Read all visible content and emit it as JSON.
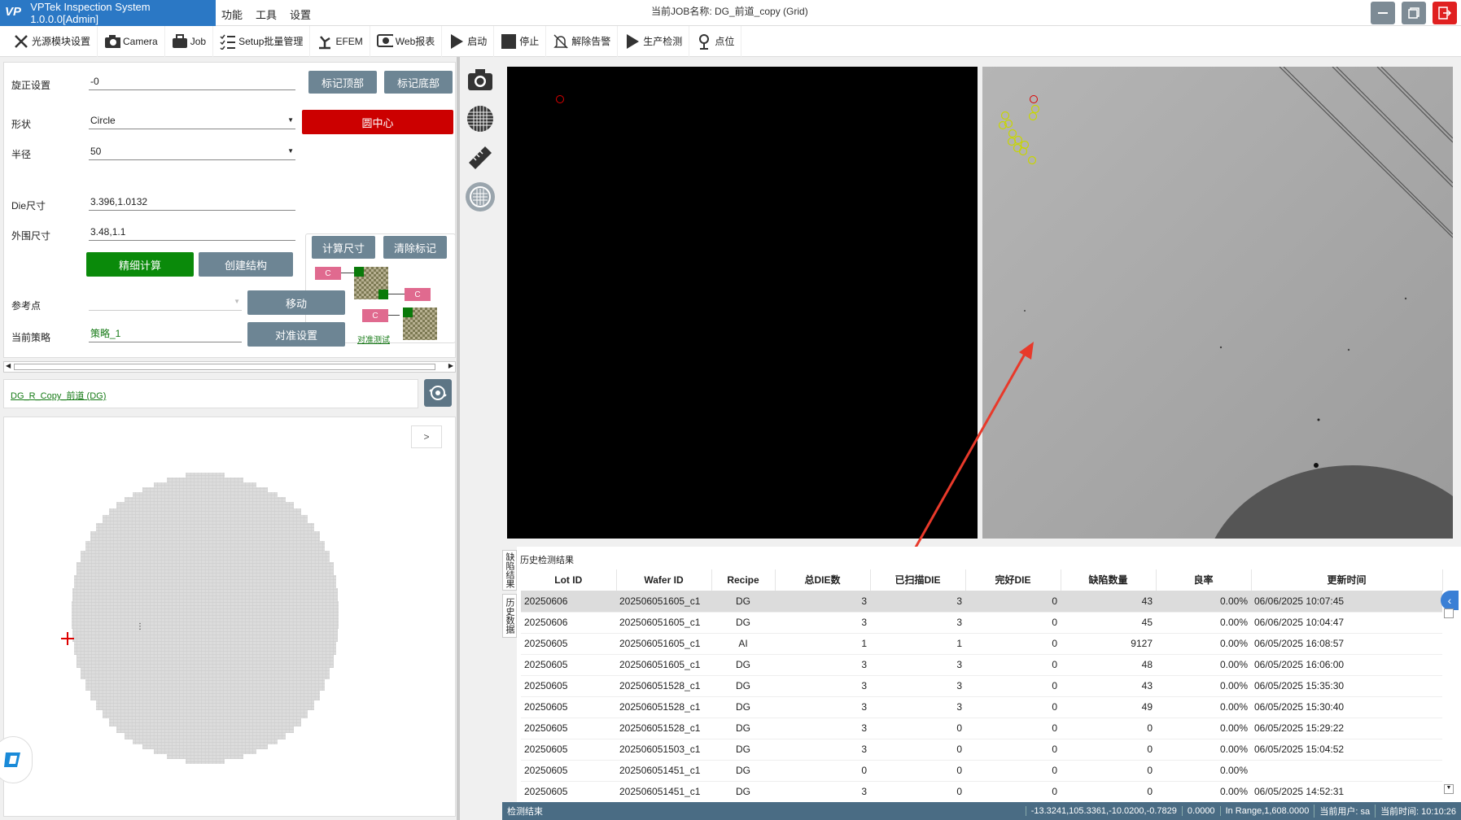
{
  "app": {
    "title": "VPTek Inspection System 1.0.0.0[Admin]",
    "logo": "VP",
    "menus": [
      "功能",
      "工具",
      "设置"
    ],
    "job_title": "当前JOB名称: DG_前道_copy (Grid)"
  },
  "toolbar": [
    {
      "label": "光源模块设置",
      "icon": "light-module-icon"
    },
    {
      "label": "Camera",
      "icon": "camera-icon"
    },
    {
      "label": "Job",
      "icon": "briefcase-icon"
    },
    {
      "label": "Setup批量管理",
      "icon": "checklist-icon"
    },
    {
      "label": "EFEM",
      "icon": "robot-arm-icon"
    },
    {
      "label": "Web报表",
      "icon": "web-report-icon"
    },
    {
      "label": "启动",
      "icon": "play-icon"
    },
    {
      "label": "停止",
      "icon": "stop-icon"
    },
    {
      "label": "解除告警",
      "icon": "bell-off-icon"
    },
    {
      "label": "生产检测",
      "icon": "play-icon"
    },
    {
      "label": "点位",
      "icon": "location-icon"
    }
  ],
  "settings": {
    "rotation_label": "旋正设置",
    "rotation_value": "-0",
    "mark_top": "标记顶部",
    "mark_bottom": "标记底部",
    "shape_label": "形状",
    "shape_value": "Circle",
    "circle_center": "圆中心",
    "radius_label": "半径",
    "radius_value": "50",
    "calc_size": "计算尺寸",
    "clear_mark": "清除标记",
    "die_label": "Die尺寸",
    "die_value": "3.396,1.0132",
    "outer_label": "外围尺寸",
    "outer_value": "3.48,1.1",
    "fine_calc": "精细计算",
    "create_struct": "创建结构",
    "ref_label": "参考点",
    "ref_value": "",
    "move": "移动",
    "strategy_label": "当前策略",
    "strategy_value": "策略_1",
    "align_setup": "对准设置",
    "align_test": "对准测试",
    "c_label": "C"
  },
  "recipe_link": "DG_R_Copy_前道 (DG)",
  "wafer_expand": ">",
  "history": {
    "title": "历史检测结果",
    "tabs": [
      "缺陷结果",
      "历史数据"
    ],
    "columns": [
      "Lot ID",
      "Wafer ID",
      "Recipe",
      "总DIE数",
      "已扫描DIE",
      "完好DIE",
      "缺陷数量",
      "良率",
      "更新时间"
    ],
    "rows": [
      [
        "20250606",
        "202506051605_c1",
        "DG",
        "3",
        "3",
        "0",
        "43",
        "0.00%",
        "06/06/2025 10:07:45"
      ],
      [
        "20250606",
        "202506051605_c1",
        "DG",
        "3",
        "3",
        "0",
        "45",
        "0.00%",
        "06/06/2025 10:04:47"
      ],
      [
        "20250605",
        "202506051605_c1",
        "AI",
        "1",
        "1",
        "0",
        "9127",
        "0.00%",
        "06/05/2025 16:08:57"
      ],
      [
        "20250605",
        "202506051605_c1",
        "DG",
        "3",
        "3",
        "0",
        "48",
        "0.00%",
        "06/05/2025 16:06:00"
      ],
      [
        "20250605",
        "202506051528_c1",
        "DG",
        "3",
        "3",
        "0",
        "43",
        "0.00%",
        "06/05/2025 15:35:30"
      ],
      [
        "20250605",
        "202506051528_c1",
        "DG",
        "3",
        "3",
        "0",
        "49",
        "0.00%",
        "06/05/2025 15:30:40"
      ],
      [
        "20250605",
        "202506051528_c1",
        "DG",
        "3",
        "0",
        "0",
        "0",
        "0.00%",
        "06/05/2025 15:29:22"
      ],
      [
        "20250605",
        "202506051503_c1",
        "DG",
        "3",
        "0",
        "0",
        "0",
        "0.00%",
        "06/05/2025 15:04:52"
      ],
      [
        "20250605",
        "202506051451_c1",
        "DG",
        "0",
        "0",
        "0",
        "0",
        "0.00%",
        ""
      ],
      [
        "20250605",
        "202506051451_c1",
        "DG",
        "3",
        "0",
        "0",
        "0",
        "0.00%",
        "06/05/2025 14:52:31"
      ]
    ]
  },
  "status": {
    "left": "检测结束",
    "coords": "-13.3241,105.3361,-10.0200,-0.7829",
    "value": "0.0000",
    "range": "In Range,1,608.0000",
    "user": "当前用户: sa",
    "time": "当前时间: 10:10:26"
  }
}
